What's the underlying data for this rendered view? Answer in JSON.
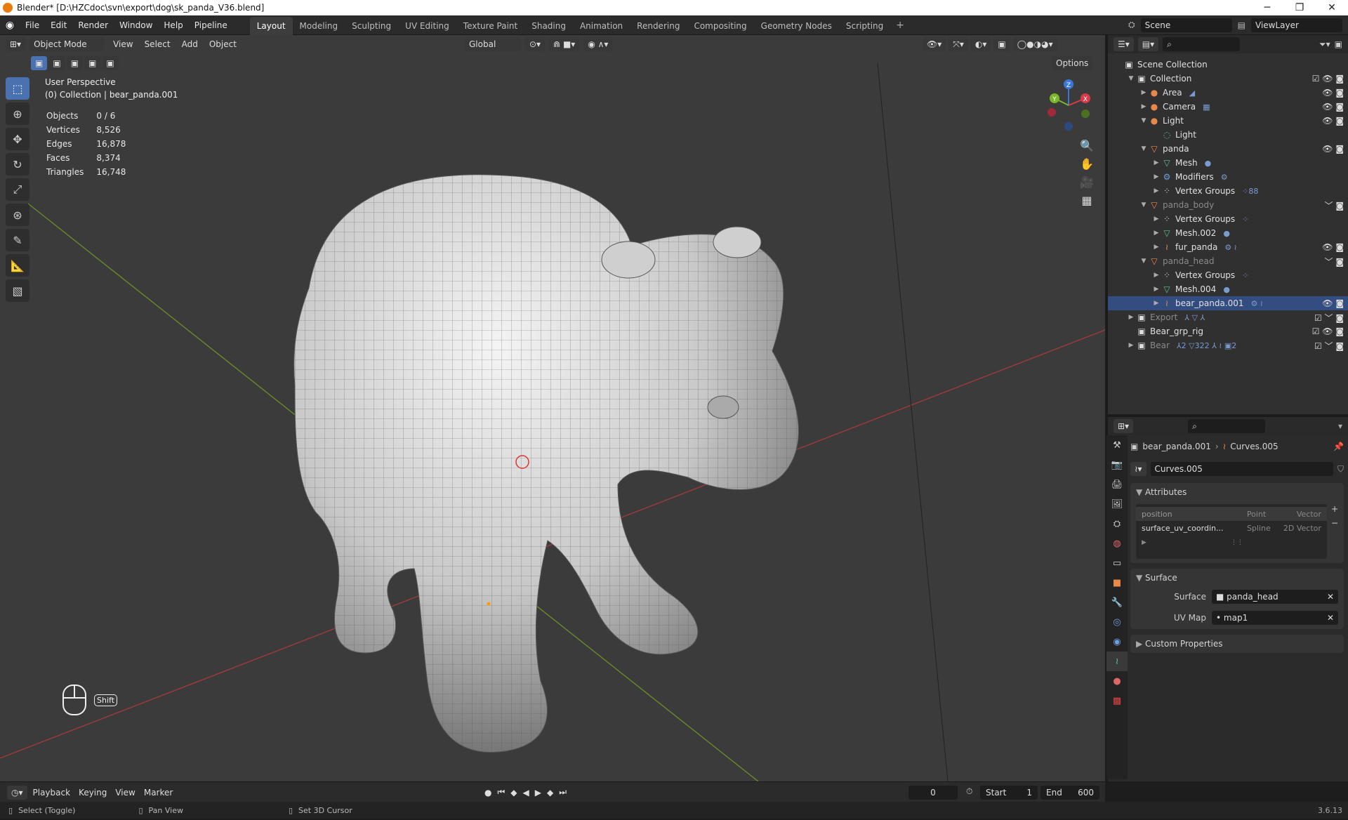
{
  "window": {
    "title": "Blender* [D:\\HZCdoc\\svn\\export\\dog\\sk_panda_V36.blend]",
    "minimize": "─",
    "maximize": "❐",
    "close": "✕"
  },
  "menu": [
    "File",
    "Edit",
    "Render",
    "Window",
    "Help",
    "Pipeline"
  ],
  "workspaces": [
    "Layout",
    "Modeling",
    "Sculpting",
    "UV Editing",
    "Texture Paint",
    "Shading",
    "Animation",
    "Rendering",
    "Compositing",
    "Geometry Nodes",
    "Scripting"
  ],
  "workspace_add": "+",
  "scene": {
    "name": "Scene",
    "view_layer": "ViewLayer"
  },
  "viewport_header": {
    "mode": "Object Mode",
    "menus": [
      "View",
      "Select",
      "Add",
      "Object"
    ],
    "orientation": "Global",
    "options": "Options"
  },
  "overlay_text": {
    "view_name": "User Perspective",
    "collection": "(0) Collection | bear_panda.001"
  },
  "stats": [
    {
      "label": "Objects",
      "value": "0 / 6"
    },
    {
      "label": "Vertices",
      "value": "8,526"
    },
    {
      "label": "Edges",
      "value": "16,878"
    },
    {
      "label": "Faces",
      "value": "8,374"
    },
    {
      "label": "Triangles",
      "value": "16,748"
    }
  ],
  "shift_key": "Shift",
  "gizmo_axes": {
    "x": "X",
    "y": "Y",
    "z": "Z"
  },
  "outliner": {
    "rows": [
      {
        "indent": 0,
        "tri": "",
        "icon": "▣",
        "label": "Scene Collection",
        "color": "#ddd",
        "right": ""
      },
      {
        "indent": 1,
        "tri": "▼",
        "icon": "▣",
        "label": "Collection",
        "color": "#ddd",
        "right": "☑ 👁 ◙"
      },
      {
        "indent": 2,
        "tri": "▶",
        "icon": "●",
        "label": "Area",
        "color": "#e8894a",
        "right": "👁 ◙",
        "extra": "◢"
      },
      {
        "indent": 2,
        "tri": "▶",
        "icon": "●",
        "label": "Camera",
        "color": "#e8894a",
        "right": "👁 ◙",
        "extra": "▦"
      },
      {
        "indent": 2,
        "tri": "▼",
        "icon": "●",
        "label": "Light",
        "color": "#e8894a",
        "right": "👁 ◙"
      },
      {
        "indent": 3,
        "tri": "",
        "icon": "◌",
        "label": "Light",
        "color": "#5fbf8f",
        "right": ""
      },
      {
        "indent": 2,
        "tri": "▼",
        "icon": "▽",
        "label": "panda",
        "color": "#e8894a",
        "right": "👁 ◙"
      },
      {
        "indent": 3,
        "tri": "▶",
        "icon": "▽",
        "label": "Mesh",
        "color": "#5fbf8f",
        "right": "",
        "extra": "●"
      },
      {
        "indent": 3,
        "tri": "▶",
        "icon": "⚙",
        "label": "Modifiers",
        "color": "#6fa0e0",
        "right": "",
        "extra": "⚙"
      },
      {
        "indent": 3,
        "tri": "▶",
        "icon": "⁘",
        "label": "Vertex Groups",
        "color": "#ccc",
        "right": "",
        "extra": "⁘88"
      },
      {
        "indent": 2,
        "tri": "▼",
        "icon": "▽",
        "label": "panda_body",
        "color": "#e8894a",
        "right": "﹀ ◙",
        "dim": true
      },
      {
        "indent": 3,
        "tri": "▶",
        "icon": "⁘",
        "label": "Vertex Groups",
        "color": "#ccc",
        "right": "",
        "extra": "⁘"
      },
      {
        "indent": 3,
        "tri": "▶",
        "icon": "▽",
        "label": "Mesh.002",
        "color": "#5fbf8f",
        "right": "",
        "extra": "●"
      },
      {
        "indent": 3,
        "tri": "▶",
        "icon": "≀",
        "label": "fur_panda",
        "color": "#e8894a",
        "right": "👁 ◙",
        "extra": "⚙ ≀"
      },
      {
        "indent": 2,
        "tri": "▼",
        "icon": "▽",
        "label": "panda_head",
        "color": "#e8894a",
        "right": "﹀ ◙",
        "dim": true
      },
      {
        "indent": 3,
        "tri": "▶",
        "icon": "⁘",
        "label": "Vertex Groups",
        "color": "#ccc",
        "right": "",
        "extra": "⁘"
      },
      {
        "indent": 3,
        "tri": "▶",
        "icon": "▽",
        "label": "Mesh.004",
        "color": "#5fbf8f",
        "right": "",
        "extra": "●"
      },
      {
        "indent": 3,
        "tri": "▶",
        "icon": "≀",
        "label": "bear_panda.001",
        "color": "#e8894a",
        "right": "👁 ◙",
        "extra": "⚙ ≀",
        "sel": true
      },
      {
        "indent": 1,
        "tri": "▶",
        "icon": "▣",
        "label": "Export",
        "color": "#ddd",
        "right": "☑ ﹀ ◙",
        "extra": "⅄ ▽ ⅄",
        "dim": true
      },
      {
        "indent": 1,
        "tri": "",
        "icon": "▣",
        "label": "Bear_grp_rig",
        "color": "#ddd",
        "right": "☑ 👁 ◙"
      },
      {
        "indent": 1,
        "tri": "▶",
        "icon": "▣",
        "label": "Bear",
        "color": "#ddd",
        "right": "☑ ﹀ ◙",
        "extra": "⅄2 ▽322 ⅄ ≀ ▣2",
        "dim": true
      }
    ]
  },
  "properties": {
    "breadcrumb_object": "bear_panda.001",
    "breadcrumb_data": "Curves.005",
    "datablock": "Curves.005",
    "attributes_title": "Attributes",
    "attributes": [
      {
        "name": "position",
        "domain": "Point",
        "type": "Vector"
      },
      {
        "name": "surface_uv_coordin...",
        "domain": "Spline",
        "type": "2D Vector"
      }
    ],
    "surface_title": "Surface",
    "surface_label": "Surface",
    "surface_value": "panda_head",
    "uvmap_label": "UV Map",
    "uvmap_value": "map1",
    "custom_title": "Custom Properties"
  },
  "timeline": {
    "menus": [
      "Playback",
      "Keying",
      "View",
      "Marker"
    ],
    "current": "0",
    "start_label": "Start",
    "start": "1",
    "end_label": "End",
    "end": "600"
  },
  "status": {
    "left": "Select (Toggle)",
    "mid": "Pan View",
    "right": "Set 3D Cursor",
    "version": "3.6.13"
  },
  "colors": {
    "accent": "#4a72b0",
    "orange": "#e8894a",
    "green": "#5fbf8f"
  }
}
